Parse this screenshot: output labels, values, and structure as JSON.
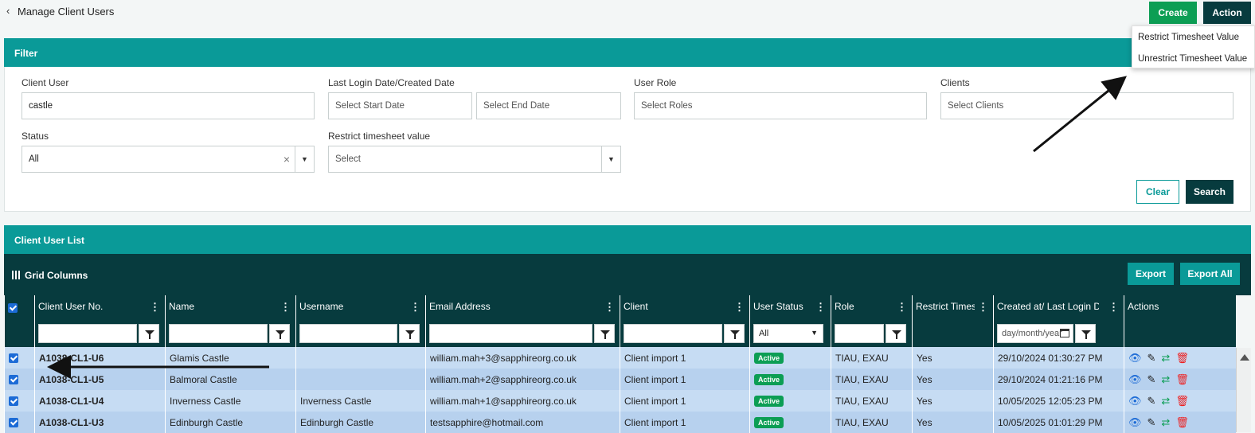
{
  "header": {
    "back_icon": "‹",
    "title": "Manage Client Users",
    "create_label": "Create",
    "action_label": "Action"
  },
  "action_menu": {
    "items": [
      "Restrict Timesheet Value",
      "Unrestrict Timesheet Value"
    ]
  },
  "filter": {
    "title": "Filter",
    "client_user": {
      "label": "Client User",
      "value": "castle"
    },
    "date": {
      "label": "Last Login Date/Created Date",
      "start_placeholder": "Select Start Date",
      "end_placeholder": "Select End Date"
    },
    "role": {
      "label": "User Role",
      "placeholder": "Select Roles"
    },
    "clients": {
      "label": "Clients",
      "placeholder": "Select Clients"
    },
    "status": {
      "label": "Status",
      "value": "All"
    },
    "restrict": {
      "label": "Restrict timesheet value",
      "value": "Select"
    },
    "clear_label": "Clear",
    "search_label": "Search"
  },
  "list": {
    "title": "Client User List",
    "grid_columns_label": "Grid Columns",
    "export_label": "Export",
    "export_all_label": "Export All",
    "columns": [
      "Client User No.",
      "Name",
      "Username",
      "Email Address",
      "Client",
      "User Status",
      "Role",
      "Restrict Times",
      "Created at/ Last Login Date",
      "Actions"
    ],
    "status_filter": "All",
    "date_placeholder": "day/month/year",
    "rows": [
      {
        "no": "A1038-CL1-U6",
        "name": "Glamis Castle",
        "username": "",
        "email": "william.mah+3@sapphireorg.co.uk",
        "client": "Client import 1",
        "status": "Active",
        "role": "TIAU, EXAU",
        "restrict": "Yes",
        "date": "29/10/2024 01:30:27 PM"
      },
      {
        "no": "A1038-CL1-U5",
        "name": "Balmoral Castle",
        "username": "",
        "email": "william.mah+2@sapphireorg.co.uk",
        "client": "Client import 1",
        "status": "Active",
        "role": "TIAU, EXAU",
        "restrict": "Yes",
        "date": "29/10/2024 01:21:16 PM"
      },
      {
        "no": "A1038-CL1-U4",
        "name": "Inverness Castle",
        "username": "Inverness Castle",
        "email": "william.mah+1@sapphireorg.co.uk",
        "client": "Client import 1",
        "status": "Active",
        "role": "TIAU, EXAU",
        "restrict": "Yes",
        "date": "10/05/2025 12:05:23 PM"
      },
      {
        "no": "A1038-CL1-U3",
        "name": "Edinburgh Castle",
        "username": "Edinburgh Castle",
        "email": "testsapphire@hotmail.com",
        "client": "Client import 1",
        "status": "Active",
        "role": "TIAU, EXAU",
        "restrict": "Yes",
        "date": "10/05/2025 01:01:29 PM"
      }
    ]
  },
  "icons": {
    "view": "eye-icon",
    "edit": "pencil-icon",
    "swap": "user-switch-icon",
    "delete": "trash-icon"
  },
  "colors": {
    "teal": "#0a9a98",
    "dark": "#073b3e",
    "green": "#0c9e54",
    "row": "#c6dcf3"
  }
}
